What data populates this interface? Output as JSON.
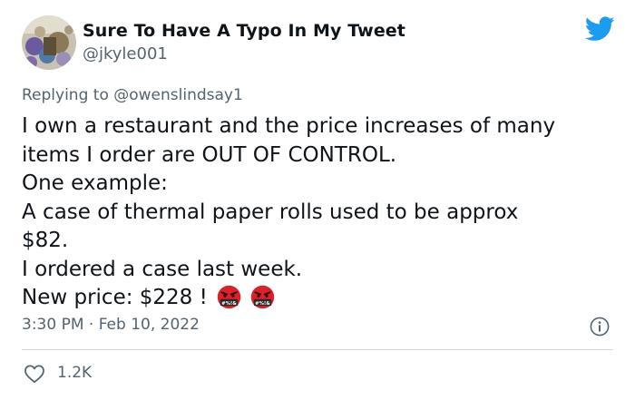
{
  "author": {
    "display_name": "Sure To Have A Typo In My Tweet",
    "handle": "@jkyle001"
  },
  "reply": {
    "prefix": "Replying to",
    "mention": "@owenslindsay1"
  },
  "tweet": {
    "lines": [
      "I own a restaurant and the price increases of many",
      "items I order are OUT OF CONTROL.",
      "One example:",
      "A case of thermal paper rolls used to be approx",
      "$82.",
      "I ordered a case last week.",
      "New price: $228 !"
    ],
    "emoji_label": "#%!&"
  },
  "meta": {
    "timestamp": "3:30 PM · Feb 10, 2022"
  },
  "stats": {
    "likes": "1.2K"
  },
  "icons": {
    "brand": "twitter-bird-icon",
    "info": "info-icon",
    "like": "heart-icon",
    "emoji": "cursing-face-emoji"
  },
  "colors": {
    "brand": "#1d9bf0",
    "text": "#0f1419",
    "muted": "#536471",
    "divider": "#cfd9de",
    "emoji_red": "#d8232a"
  }
}
